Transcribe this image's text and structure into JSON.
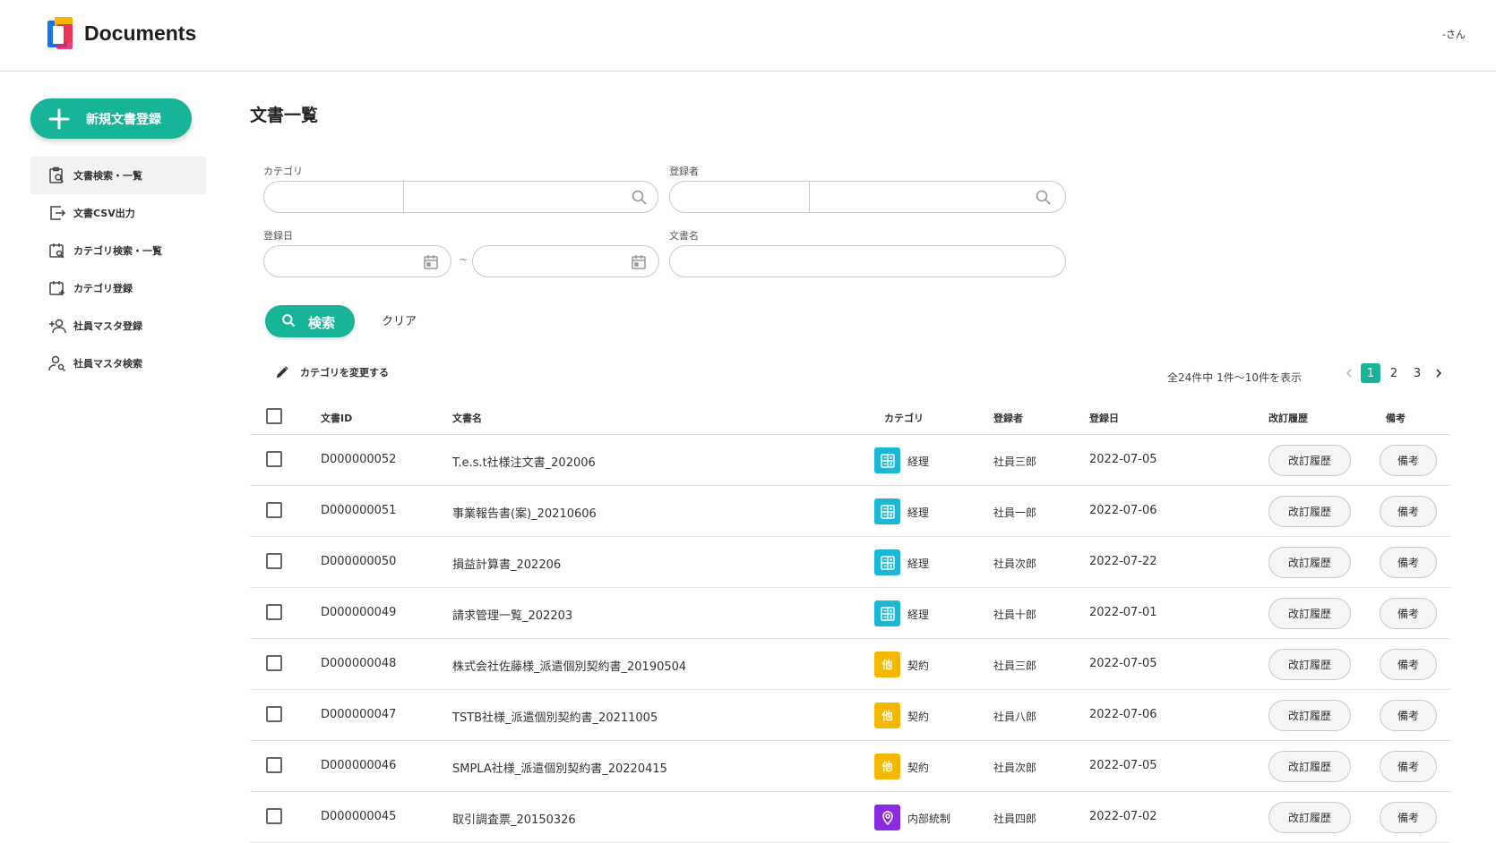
{
  "header": {
    "app_title": "Documents",
    "user": "-さん"
  },
  "sidebar": {
    "new_button": "新規文書登録",
    "items": [
      {
        "label": "文書検索・一覧",
        "icon": "document-search-icon",
        "active": true
      },
      {
        "label": "文書CSV出力",
        "icon": "csv-export-icon",
        "active": false
      },
      {
        "label": "カテゴリ検索・一覧",
        "icon": "category-search-icon",
        "active": false
      },
      {
        "label": "カテゴリ登録",
        "icon": "category-add-icon",
        "active": false
      },
      {
        "label": "社員マスタ登録",
        "icon": "user-add-icon",
        "active": false
      },
      {
        "label": "社員マスタ検索",
        "icon": "user-search-icon",
        "active": false
      }
    ]
  },
  "main": {
    "title": "文書一覧",
    "filters": {
      "category_label": "カテゴリ",
      "registrant_label": "登録者",
      "date_label": "登録日",
      "date_separator": "~",
      "doc_name_label": "文書名"
    },
    "search_button": "検索",
    "clear_button": "クリア",
    "change_category": "カテゴリを変更する",
    "pager": {
      "info": "全24件中 1件〜10件を表示",
      "pages": [
        "1",
        "2",
        "3"
      ],
      "current": "1"
    },
    "columns": [
      "文書ID",
      "文書名",
      "カテゴリ",
      "登録者",
      "登録日",
      "改訂履歴",
      "備考"
    ],
    "revision_button": "改訂履歴",
    "note_button": "備考",
    "category_styles": {
      "経理": {
        "color": "#1ab8d4",
        "icon": "calculator-icon",
        "glyph": ""
      },
      "契約": {
        "color": "#f5b800",
        "icon": "other-icon",
        "glyph": "他"
      },
      "内部統制": {
        "color": "#8a2be2",
        "icon": "location-pin-icon",
        "glyph": ""
      }
    },
    "rows": [
      {
        "id": "D000000052",
        "name": "T.e.s.t社様注文書_202006",
        "category": "経理",
        "registrant": "社員三郎",
        "date": "2022-07-05"
      },
      {
        "id": "D000000051",
        "name": "事業報告書(案)_20210606",
        "category": "経理",
        "registrant": "社員一郎",
        "date": "2022-07-06"
      },
      {
        "id": "D000000050",
        "name": "損益計算書_202206",
        "category": "経理",
        "registrant": "社員次郎",
        "date": "2022-07-22"
      },
      {
        "id": "D000000049",
        "name": "請求管理一覧_202203",
        "category": "経理",
        "registrant": "社員十郎",
        "date": "2022-07-01"
      },
      {
        "id": "D000000048",
        "name": "株式会社佐藤様_派遣個別契約書_20190504",
        "category": "契約",
        "registrant": "社員三郎",
        "date": "2022-07-05"
      },
      {
        "id": "D000000047",
        "name": "TSTB社様_派遣個別契約書_20211005",
        "category": "契約",
        "registrant": "社員八郎",
        "date": "2022-07-06"
      },
      {
        "id": "D000000046",
        "name": "SMPLA社様_派遣個別契約書_20220415",
        "category": "契約",
        "registrant": "社員次郎",
        "date": "2022-07-05"
      },
      {
        "id": "D000000045",
        "name": "取引調査票_20150326",
        "category": "内部統制",
        "registrant": "社員四郎",
        "date": "2022-07-02"
      }
    ]
  },
  "colors": {
    "accent": "#17b497"
  }
}
